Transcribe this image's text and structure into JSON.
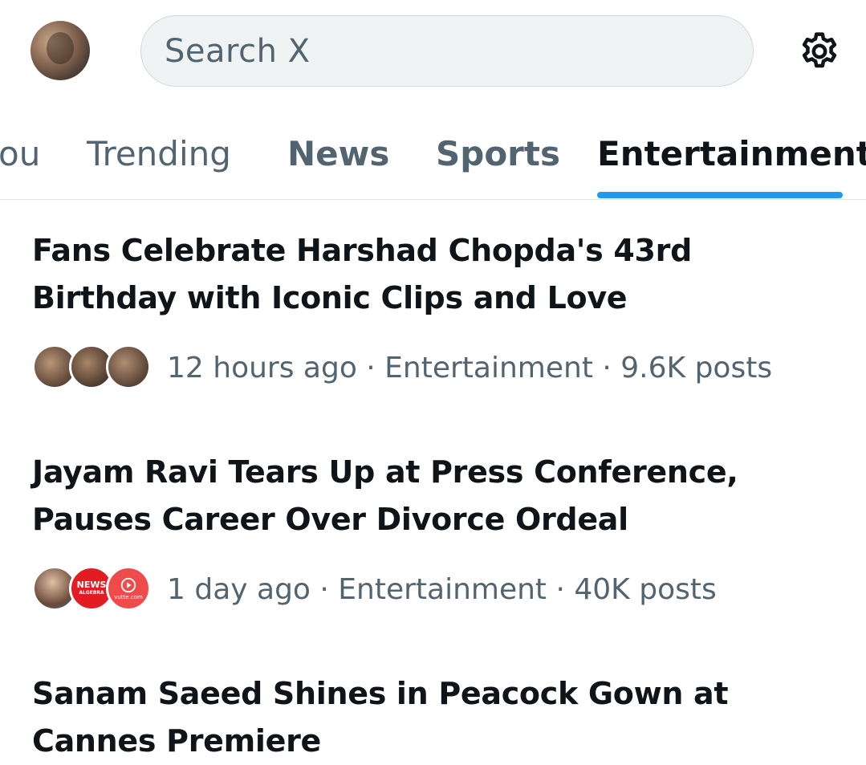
{
  "header": {
    "search_placeholder": "Search X",
    "avatar_icon": "profile-avatar",
    "settings_icon": "gear-icon"
  },
  "tabs": [
    {
      "label": "ou"
    },
    {
      "label": "Trending"
    },
    {
      "label": "News"
    },
    {
      "label": "Sports"
    },
    {
      "label": "Entertainment",
      "active": true
    }
  ],
  "trends": [
    {
      "title_line1": "Fans Celebrate Harshad Chopda's 43rd",
      "title_line2": "Birthday with Iconic Clips and Love",
      "meta": "12 hours ago · Entertainment · 9.6K posts"
    },
    {
      "title_line1": "Jayam Ravi Tears Up at Press Conference,",
      "title_line2": "Pauses Career Over Divorce Ordeal",
      "meta": "1 day ago · Entertainment · 40K posts",
      "badge_news": "NEWS",
      "badge_sub": "ALGEBRA",
      "badge_site": "vutte.com"
    },
    {
      "title_line1": "Sanam Saeed Shines in Peacock Gown at",
      "title_line2": "Cannes Premiere"
    }
  ],
  "colors": {
    "accent": "#1d9bf0",
    "text_primary": "#0f1419",
    "text_secondary": "#536471",
    "search_bg": "#eff3f4"
  }
}
